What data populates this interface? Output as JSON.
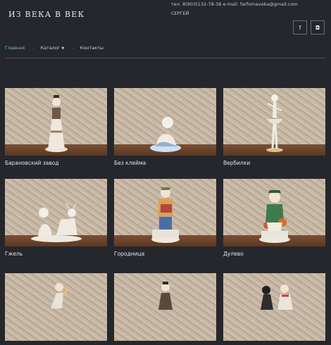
{
  "header": {
    "logo": "Из века в век",
    "contact_line": "тел. 8(903)132-78-38 e-mail: farfornaveka@gmail.com",
    "user": "СЕРГЕЙ",
    "social": [
      {
        "icon": "facebook-icon",
        "glyph": "f"
      },
      {
        "icon": "instagram-icon",
        "glyph": "◘"
      }
    ]
  },
  "nav": {
    "items": [
      {
        "label": "Главная",
        "active": true
      },
      {
        "label": "Каталог",
        "has_dropdown": true
      },
      {
        "label": "Контакты"
      }
    ],
    "separator": "-"
  },
  "catalog": {
    "cards": [
      {
        "caption": "Барановский завод"
      },
      {
        "caption": "Без клейма"
      },
      {
        "caption": "Вербилки"
      },
      {
        "caption": "Гжель"
      },
      {
        "caption": "Городница"
      },
      {
        "caption": "Дулево"
      },
      {
        "caption": ""
      },
      {
        "caption": ""
      },
      {
        "caption": ""
      }
    ]
  }
}
